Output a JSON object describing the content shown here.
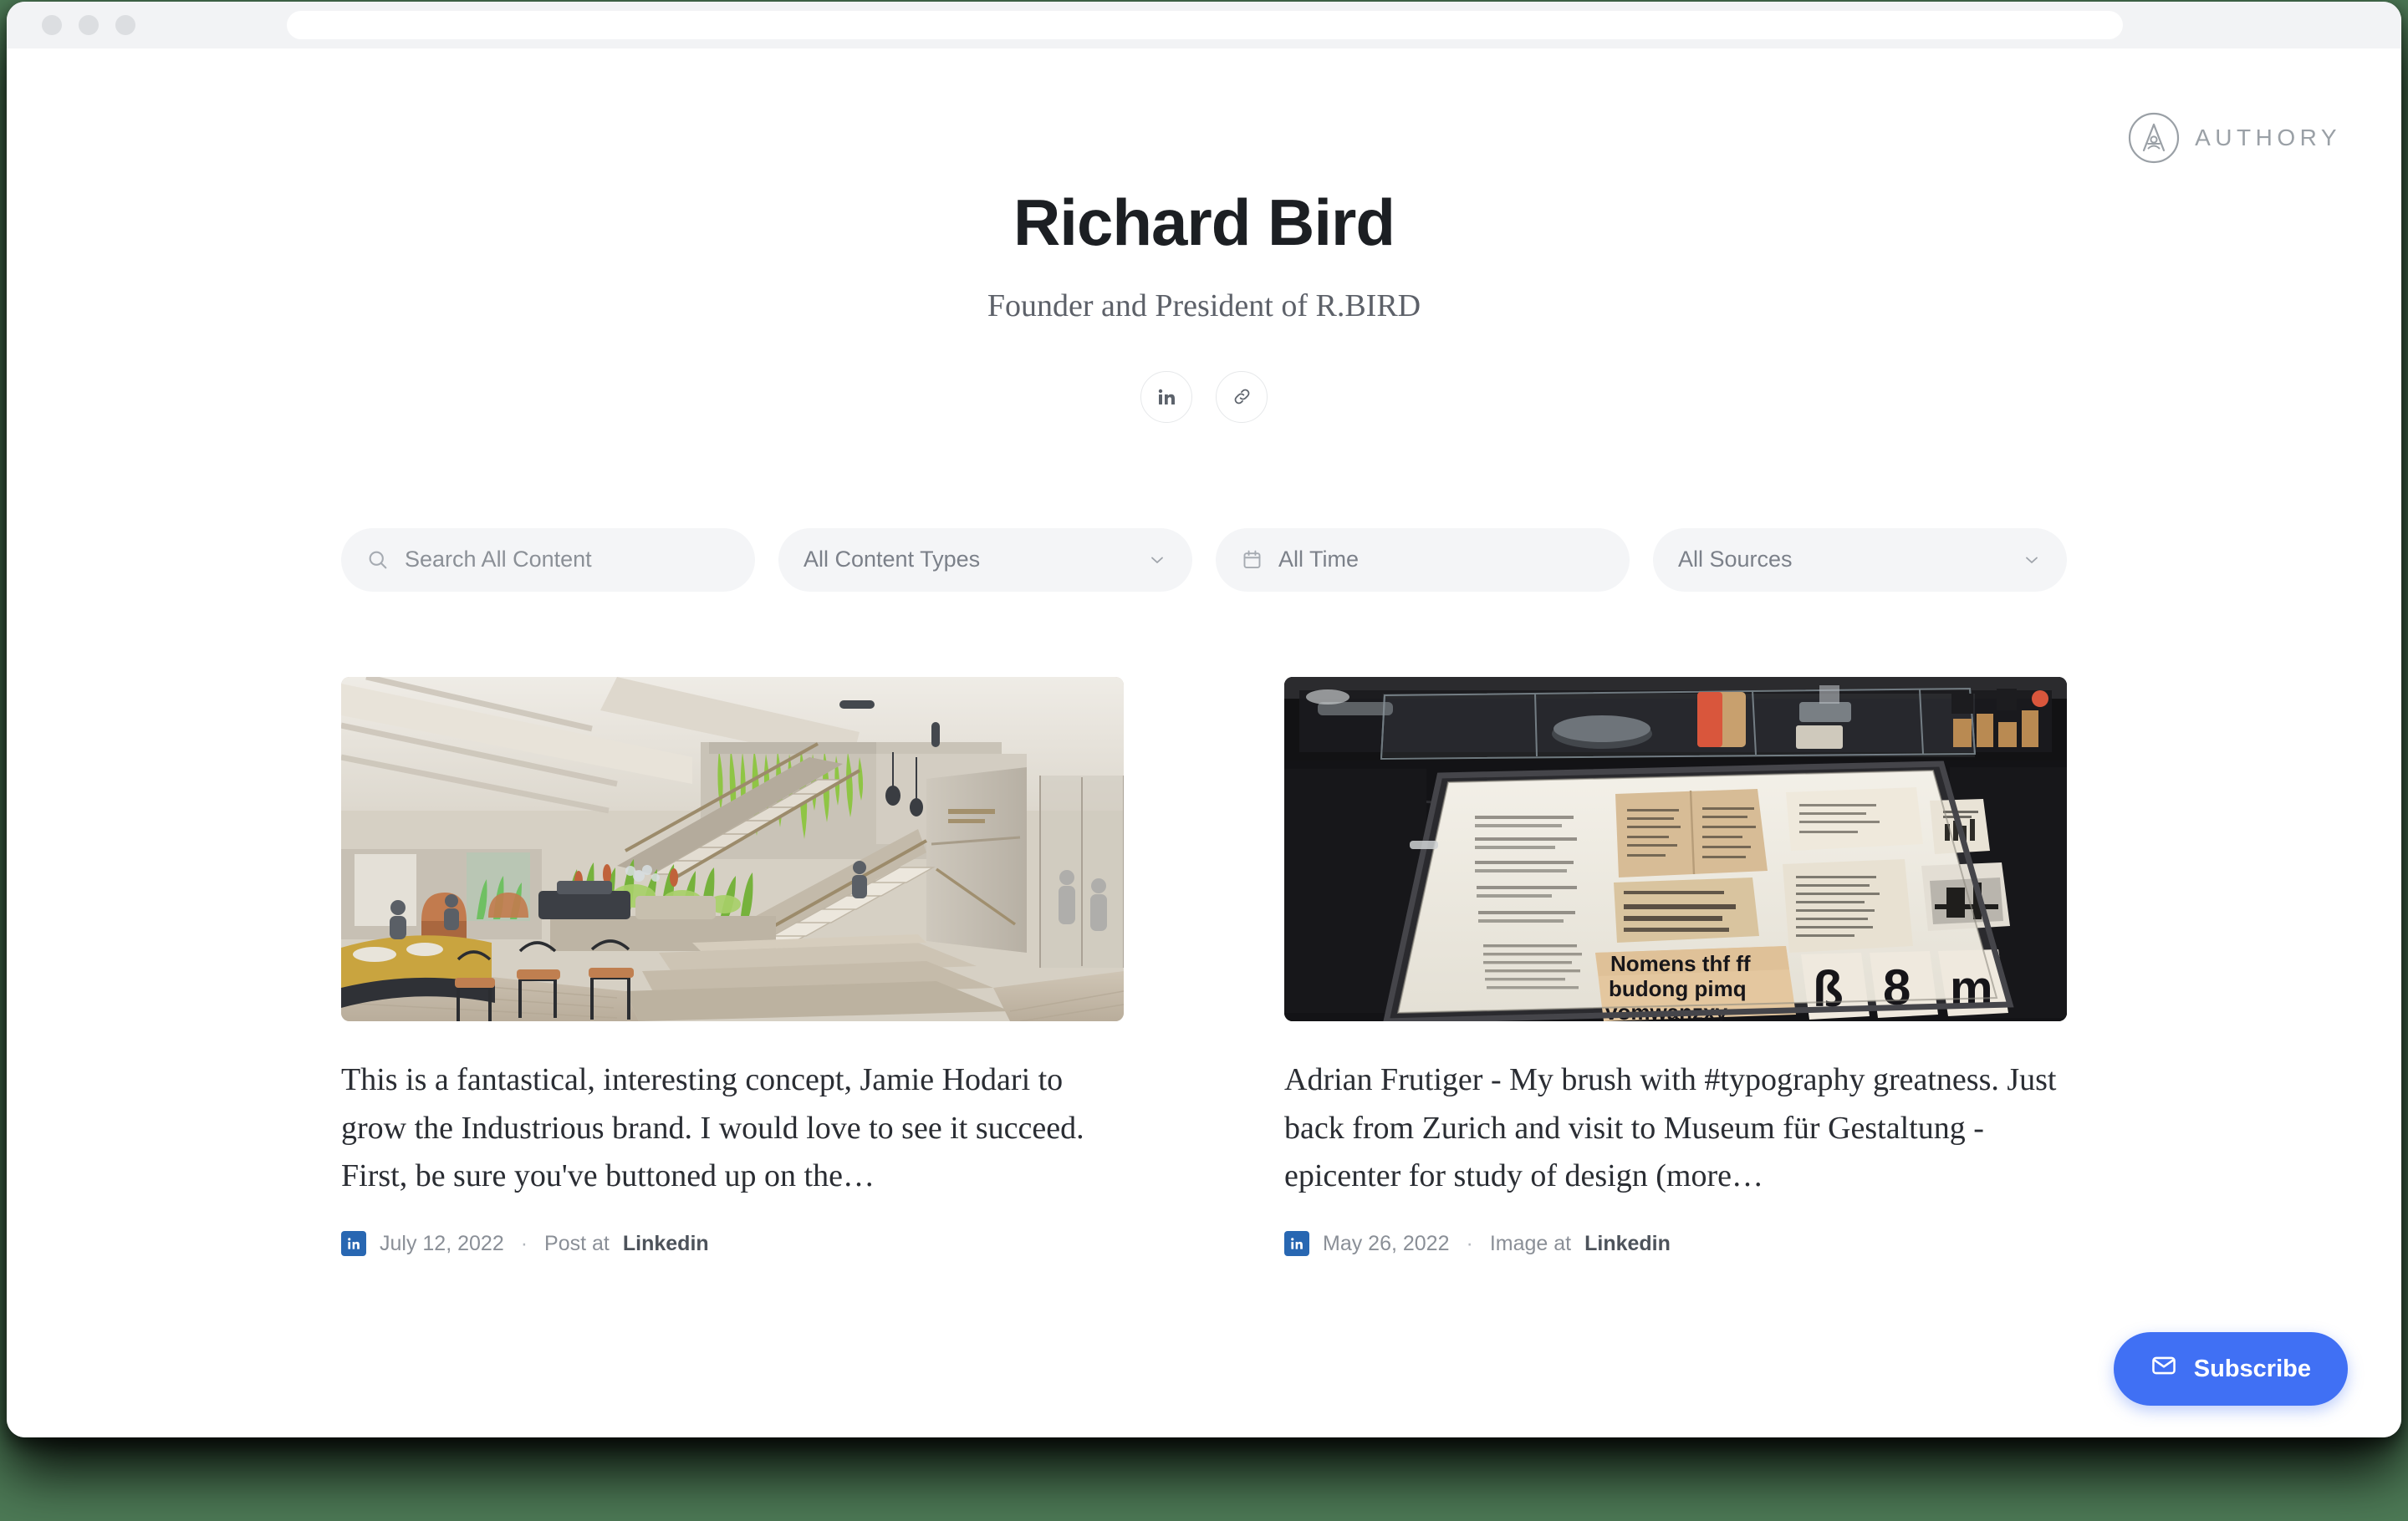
{
  "browser": {
    "url_value": "",
    "url_placeholder": "",
    "traffic_lights": [
      "close",
      "minimize",
      "maximize"
    ]
  },
  "brand": {
    "name": "AUTHORY",
    "mark_icon": "authory-compass-a-icon"
  },
  "profile": {
    "name": "Richard Bird",
    "tagline": "Founder and President of R.BIRD",
    "socials": [
      {
        "icon": "linkedin-icon",
        "label": "LinkedIn"
      },
      {
        "icon": "link-icon",
        "label": "Website"
      }
    ]
  },
  "filters": {
    "search": {
      "icon": "search-icon",
      "placeholder": "Search All Content",
      "value": ""
    },
    "content_type": {
      "label": "All Content Types",
      "chevron": "chevron-down-icon"
    },
    "time": {
      "icon": "calendar-icon",
      "label": "All Time"
    },
    "source": {
      "label": "All Sources",
      "chevron": "chevron-down-icon"
    }
  },
  "cards": [
    {
      "thumb_alt": "Industrious lobby interior render with concrete staircase and greenery",
      "title": "This is a fantastical, interesting concept, Jamie Hodari to grow the Industrious brand. I would love to see it succeed. First, be sure you've buttoned up on the…",
      "source_icon": "linkedin-icon",
      "date": "July 12, 2022",
      "separator": "·",
      "kind": "Post at",
      "source": "Linkedin"
    },
    {
      "thumb_alt": "Museum drawer display of Adrian Frutiger typography specimens",
      "title": "Adrian Frutiger - My brush with #typography greatness. Just back from Zurich and visit to Museum für Gestaltung - epicenter for study of design (more…",
      "source_icon": "linkedin-icon",
      "date": "May 26, 2022",
      "separator": "·",
      "kind": "Image at",
      "source": "Linkedin"
    }
  ],
  "subscribe": {
    "label": "Subscribe",
    "icon": "envelope-icon",
    "color": "#4070f4"
  },
  "colors": {
    "page_background": "#ffffff",
    "desktop_background": "#4d7a56",
    "chrome_background": "#f2f3f5",
    "filter_background": "#f4f5f7",
    "linkedin_blue": "#2867b2",
    "accent_blue": "#4070f4",
    "title_text": "#1c1f23",
    "muted_text": "#8a8f97"
  }
}
